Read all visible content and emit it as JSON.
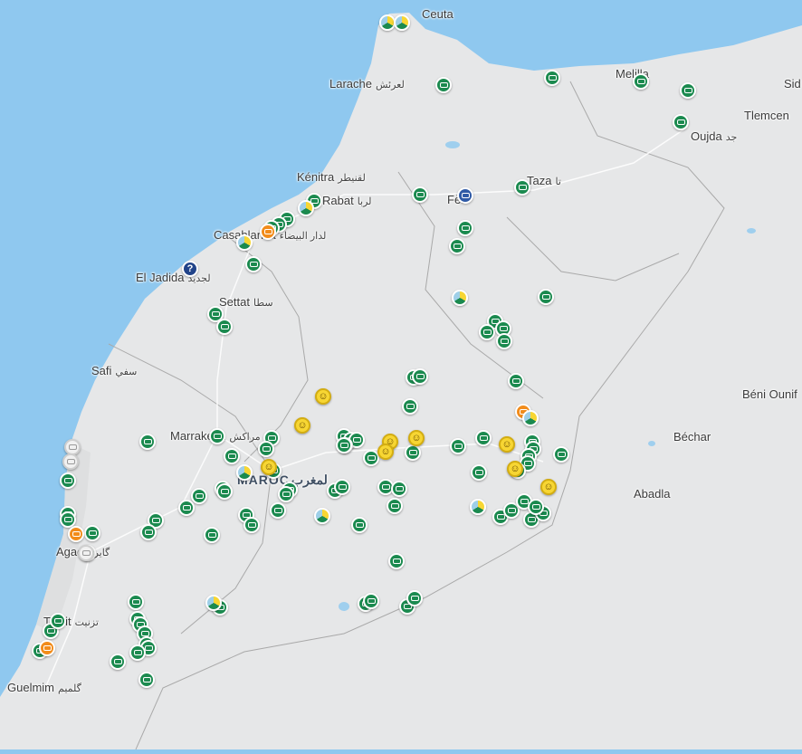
{
  "colors": {
    "sea": "#8fc8ef",
    "land": "#e6e7e8",
    "border": "#9a9a9a",
    "marker_green": "#1b8a4f",
    "marker_orange": "#f28c1b",
    "marker_smiley": "#f7d633",
    "marker_mail": "#2f5aa6",
    "marker_question": "#22448a"
  },
  "country": {
    "label": "MAROC",
    "arabic": "لمغرب"
  },
  "places": [
    {
      "id": "ceuta",
      "name": "Ceuta",
      "arabic": ""
    },
    {
      "id": "larache",
      "name": "Larache",
      "arabic": "لعرئش"
    },
    {
      "id": "melilla",
      "name": "Melilla",
      "arabic": ""
    },
    {
      "id": "sidi",
      "name": "Sid",
      "arabic": ""
    },
    {
      "id": "tlemcen",
      "name": "Tlemcen",
      "arabic": ""
    },
    {
      "id": "oujda",
      "name": "Oujda",
      "arabic": "جد"
    },
    {
      "id": "kenitra",
      "name": "Kénitra",
      "arabic": "لقنيطر"
    },
    {
      "id": "rabat",
      "name": "Rabat",
      "arabic": "لربا"
    },
    {
      "id": "fes",
      "name": "Fès",
      "arabic": ""
    },
    {
      "id": "taza",
      "name": "Taza",
      "arabic": "تا"
    },
    {
      "id": "casablanca",
      "name": "Casablanca",
      "arabic": "لدار البيضاء"
    },
    {
      "id": "eljadida",
      "name": "El Jadida",
      "arabic": "لجديد"
    },
    {
      "id": "settat",
      "name": "Settat",
      "arabic": "سطا"
    },
    {
      "id": "safi",
      "name": "Safi",
      "arabic": "سفي"
    },
    {
      "id": "beniounif",
      "name": "Béni Ounif",
      "arabic": ""
    },
    {
      "id": "marrakech",
      "name": "Marrakech",
      "arabic": "مراكش"
    },
    {
      "id": "bechar",
      "name": "Béchar",
      "arabic": ""
    },
    {
      "id": "abadla",
      "name": "Abadla",
      "arabic": ""
    },
    {
      "id": "agadir",
      "name": "Agadir",
      "arabic": "گاير"
    },
    {
      "id": "tiznit",
      "name": "Tiznit",
      "arabic": "تزنيت"
    },
    {
      "id": "guelmim",
      "name": "Guelmim",
      "arabic": "گلميم"
    }
  ],
  "markers": {
    "green": 120,
    "orange": 4,
    "smiley": 9,
    "mixed": 10,
    "white": 3,
    "mail": 1,
    "question": 1
  }
}
